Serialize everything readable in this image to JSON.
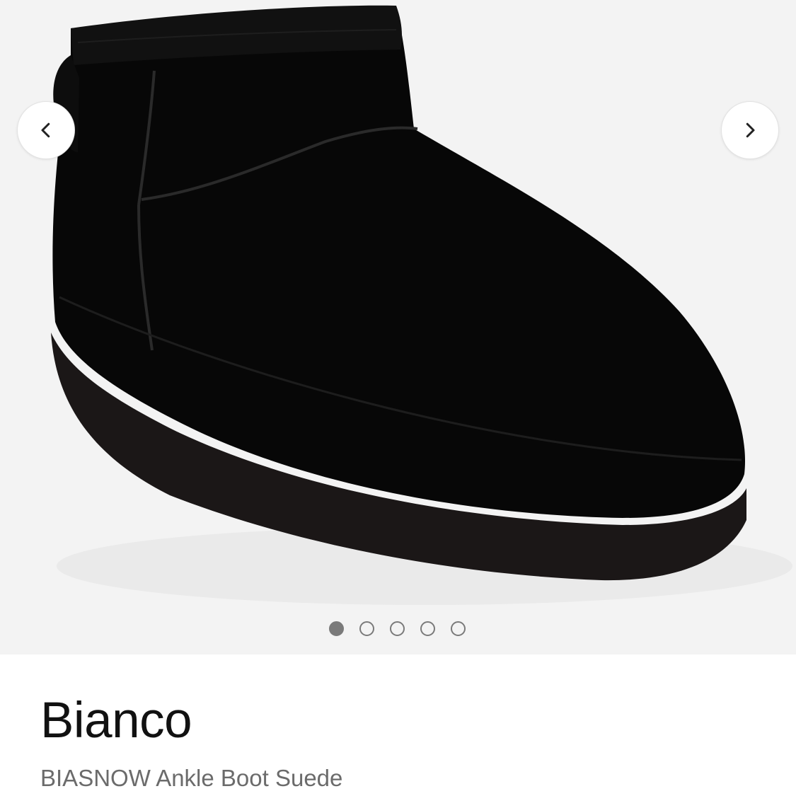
{
  "gallery": {
    "image_alt": "Black suede ankle boot",
    "prev_icon": "chevron-left-icon",
    "next_icon": "chevron-right-icon",
    "slide_count": 5,
    "active_slide": 1,
    "background_color": "#f3f3f3"
  },
  "product": {
    "brand": "Bianco",
    "name": "BIASNOW Ankle Boot Suede"
  },
  "colors": {
    "dot_color": "#7a7a7a",
    "brand_text": "#111111",
    "name_text": "#6b6b6b"
  }
}
